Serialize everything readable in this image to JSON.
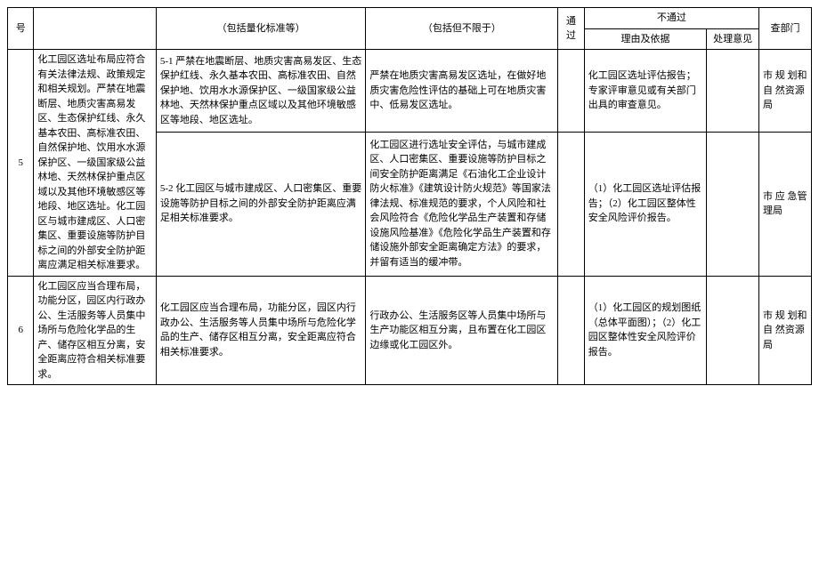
{
  "headers": {
    "col_num": "号",
    "col_std_suffix": "（包括量化标准等）",
    "col_incl_suffix": "（包括但不限于）",
    "col_pass": "通过",
    "col_notpass": "不通过",
    "col_reason": "理由及依据",
    "col_opinion": "处理意见",
    "col_dept": "查部门"
  },
  "rows": [
    {
      "num": "5",
      "desc": "化工园区选址布局应符合有关法律法规、政策规定和相关规划。严禁在地震断层、地质灾害高易发区、生态保护红线、永久基本农田、高标准农田、自然保护地、饮用水水源保护区、一级国家级公益林地、天然林保护重点区域以及其他环境敏感区等地段、地区选址。化工园区与城市建成区、人口密集区、重要设施等防护目标之间的外部安全防护距离应满足相关标准要求。",
      "sub": [
        {
          "std": "5-1 严禁在地震断层、地质灾害高易发区、生态保护红线、永久基本农田、高标准农田、自然保护地、饮用水水源保护区、一级国家级公益林地、天然林保护重点区域以及其他环境敏感区等地段、地区选址。",
          "incl": "严禁在地质灾害高易发区选址，在做好地质灾害危险性评估的基础上可在地质灾害中、低易发区选址。",
          "reason": "化工园区选址评估报告；专家评审意见或有关部门出具的审查意见。",
          "dept": "市 规 划和 自 然资源局"
        },
        {
          "std": "5-2 化工园区与城市建成区、人口密集区、重要设施等防护目标之间的外部安全防护距离应满足相关标准要求。",
          "incl": "化工园区进行选址安全评估，与城市建成区、人口密集区、重要设施等防护目标之间安全防护距离满足《石油化工企业设计防火标准》《建筑设计防火规范》等国家法律法规、标准规范的要求，个人风险和社会风险符合《危险化学品生产装置和存储设施风险基准》《危险化学品生产装置和存储设施外部安全距离确定方法》的要求，并留有适当的缓冲带。",
          "reason": "（1）化工园区选址评估报告；（2）化工园区整体性安全风险评价报告。",
          "dept": "市 应 急管理局"
        }
      ]
    },
    {
      "num": "6",
      "desc": "化工园区应当合理布局，功能分区，园区内行政办公、生活服务等人员集中场所与危险化学品的生产、储存区相互分离，安全距离应符合相关标准要求。",
      "std": "化工园区应当合理布局，功能分区，园区内行政办公、生活服务等人员集中场所与危险化学品的生产、储存区相互分离，安全距离应符合相关标准要求。",
      "incl": "行政办公、生活服务区等人员集中场所与生产功能区相互分离，且布置在化工园区边缘或化工园区外。",
      "reason": "（1）化工园区的规划图纸（总体平面图）；（2）化工园区整体性安全风险评价报告。",
      "dept": "市 规 划和 自 然资源局"
    }
  ]
}
